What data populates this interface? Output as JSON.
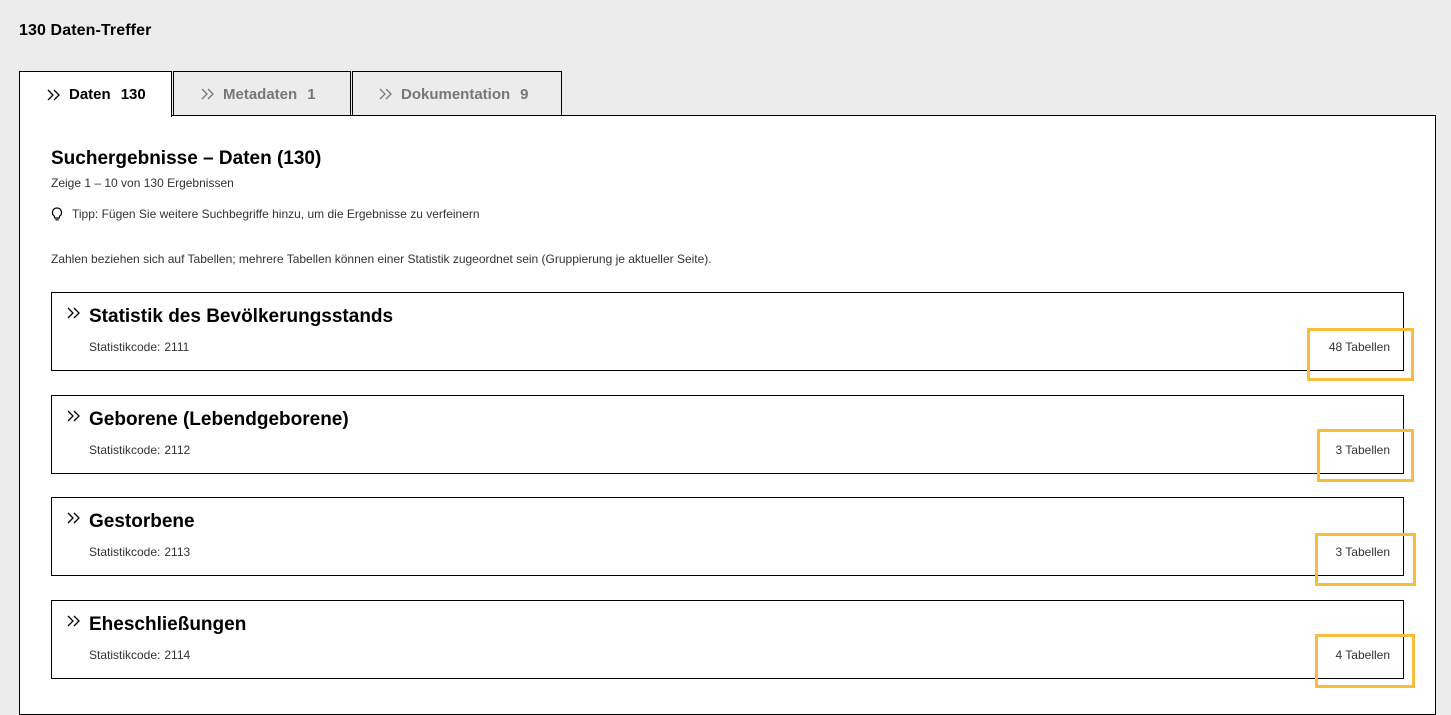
{
  "hits_title": "130 Daten-Treffer",
  "tabs": [
    {
      "label": "Daten",
      "count": "130",
      "active": true
    },
    {
      "label": "Metadaten",
      "count": "1",
      "active": false
    },
    {
      "label": "Dokumentation",
      "count": "9",
      "active": false
    }
  ],
  "results": {
    "heading": "Suchergebnisse – Daten (130)",
    "subtitle": "Zeige 1 – 10 von 130 Ergebnissen",
    "tip": "Tipp: Fügen Sie weitere Suchbegriffe hinzu, um die Ergebnisse zu verfeinern",
    "note": "Zahlen beziehen sich auf Tabellen; mehrere Tabellen können einer Statistik zugeordnet sein (Gruppierung je aktueller Seite)."
  },
  "code_label": "Statistikcode:",
  "statistics": [
    {
      "title": "Statistik des Bevölkerungsstands",
      "code": "2111",
      "tables": "48 Tabellen"
    },
    {
      "title": "Geborene (Lebendgeborene)",
      "code": "2112",
      "tables": "3 Tabellen"
    },
    {
      "title": "Gestorbene",
      "code": "2113",
      "tables": "3 Tabellen"
    },
    {
      "title": "Eheschließungen",
      "code": "2114",
      "tables": "4 Tabellen"
    }
  ],
  "icons": {
    "chevron": "double-chevron-right-icon",
    "tip": "lightbulb-icon"
  },
  "colors": {
    "highlight": "#f9bb3c",
    "background": "#ececec",
    "panel": "#ffffff"
  }
}
